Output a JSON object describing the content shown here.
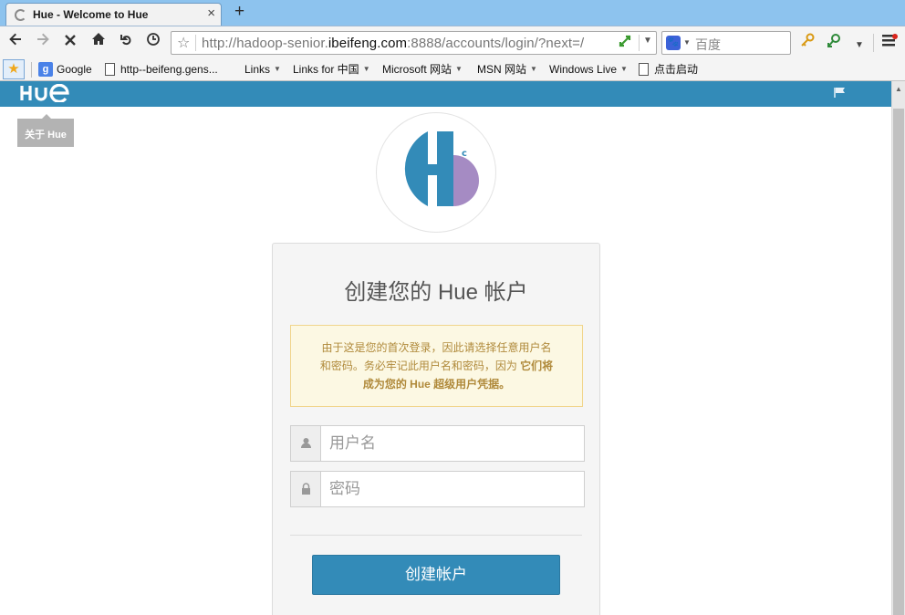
{
  "browser": {
    "tab_title": "Hue - Welcome to Hue",
    "tab_close": "×",
    "new_tab": "+",
    "url_prefix": "http://hadoop-senior.",
    "url_domain": "ibeifeng.com",
    "url_suffix": ":8888/accounts/login/?next=/",
    "search_placeholder": "百度",
    "search_engine_icon": "baidu-paw-icon",
    "nav_icons": [
      "back-arrow-icon",
      "forward-arrow-icon",
      "stop-icon",
      "home-icon",
      "undo-icon",
      "history-icon"
    ],
    "bookmarks": [
      {
        "label": "Google",
        "icon": "google-icon"
      },
      {
        "label": "http--beifeng.gens...",
        "icon": "page-icon"
      },
      {
        "label": "Links",
        "dropdown": true
      },
      {
        "label": "Links for 中国",
        "dropdown": true
      },
      {
        "label": "Microsoft 网站",
        "dropdown": true
      },
      {
        "label": "MSN 网站",
        "dropdown": true
      },
      {
        "label": "Windows Live",
        "dropdown": true
      },
      {
        "label": "点击启动",
        "icon": "page-icon"
      }
    ]
  },
  "hue": {
    "logo": "HUE",
    "about_tooltip": "关于 Hue",
    "brand_colors": {
      "blue": "#338BB8",
      "purple": "#A58BC3"
    },
    "card": {
      "title": "创建您的 Hue 帐户",
      "notice_text": "由于这是您的首次登录，因此请选择任意用户名和密码。务必牢记此用户名和密码，因为",
      "notice_bold": "它们将成为您的 Hue 超级用户凭据。",
      "username_placeholder": "用户名",
      "password_placeholder": "密码",
      "submit_label": "创建帐户"
    }
  }
}
